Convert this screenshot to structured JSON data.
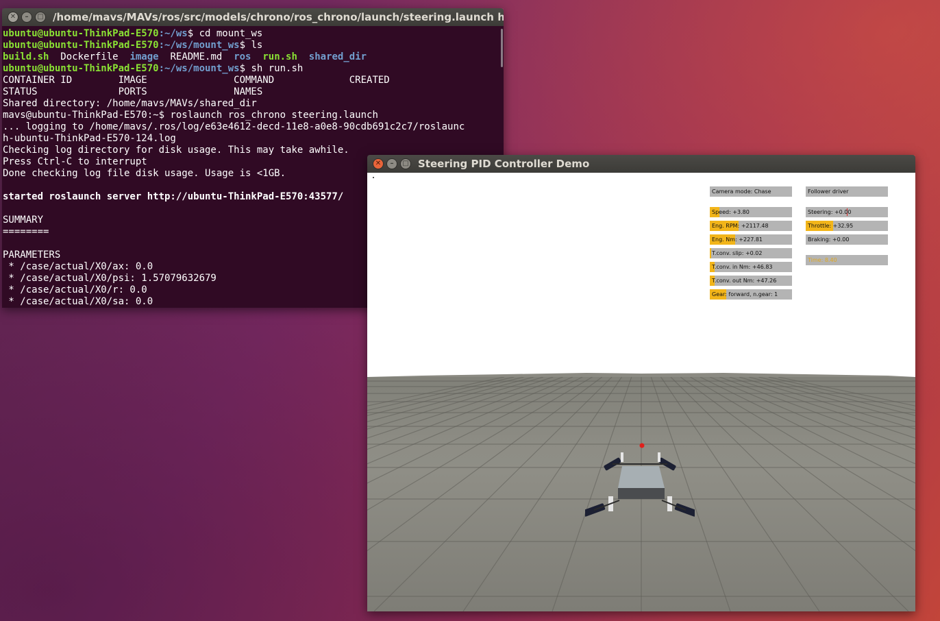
{
  "terminal": {
    "title": "/home/mavs/MAVs/ros/src/models/chrono/ros_chrono/launch/steering.launch http://loc",
    "lines": [
      {
        "user": "ubuntu@ubuntu-ThinkPad-E570",
        "path": ":~/ws",
        "cmd": "$ cd mount_ws"
      },
      {
        "user": "ubuntu@ubuntu-ThinkPad-E570",
        "path": ":~/ws/mount_ws",
        "cmd": "$ ls"
      },
      {
        "ls": [
          "build.sh",
          "Dockerfile",
          "image",
          "README.md",
          "ros",
          "run.sh",
          "shared_dir"
        ]
      },
      {
        "user": "ubuntu@ubuntu-ThinkPad-E570",
        "path": ":~/ws/mount_ws",
        "cmd": "$ sh run.sh"
      },
      {
        "text": "CONTAINER ID        IMAGE               COMMAND             CREATED"
      },
      {
        "text": "STATUS              PORTS               NAMES"
      },
      {
        "text": "Shared directory: /home/mavs/MAVs/shared_dir"
      },
      {
        "text": "mavs@ubuntu-ThinkPad-E570:~$ roslaunch ros_chrono steering.launch"
      },
      {
        "text": "... logging to /home/mavs/.ros/log/e63e4612-decd-11e8-a0e8-90cdb691c2c7/roslaunc"
      },
      {
        "text": "h-ubuntu-ThinkPad-E570-124.log"
      },
      {
        "text": "Checking log directory for disk usage. This may take awhile."
      },
      {
        "text": "Press Ctrl-C to interrupt"
      },
      {
        "text": "Done checking log file disk usage. Usage is <1GB."
      },
      {
        "text": ""
      },
      {
        "text": "started roslaunch server http://ubuntu-ThinkPad-E570:43577/",
        "bold": true
      },
      {
        "text": ""
      },
      {
        "text": "SUMMARY"
      },
      {
        "text": "========"
      },
      {
        "text": ""
      },
      {
        "text": "PARAMETERS"
      },
      {
        "text": " * /case/actual/X0/ax: 0.0"
      },
      {
        "text": " * /case/actual/X0/psi: 1.57079632679"
      },
      {
        "text": " * /case/actual/X0/r: 0.0"
      },
      {
        "text": " * /case/actual/X0/sa: 0.0"
      }
    ]
  },
  "demo": {
    "title": "Steering PID Controller Demo",
    "hud_left": [
      {
        "text": "Camera mode: Chase",
        "fill": 0
      },
      {
        "text": "Speed: +3.80",
        "fill": 0.12
      },
      {
        "text": "Eng. RPM: +2117.48",
        "fill": 0.35
      },
      {
        "text": "Eng. Nm: +227.81",
        "fill": 0.31
      },
      {
        "text": "T.conv. slip: +0.02",
        "fill": 0.02
      },
      {
        "text": "T.conv. in  Nm: +46.83",
        "fill": 0.06
      },
      {
        "text": "T.conv. out Nm: +47.26",
        "fill": 0.06
      },
      {
        "text": "Gear: forward, n.gear: 1",
        "fill": 0.2
      }
    ],
    "hud_right": [
      {
        "text": "Follower driver",
        "fill": 0
      },
      {
        "text": "Steering: +0.00",
        "fill": 0,
        "marker": 0.5
      },
      {
        "text": "Throttle: +32.95",
        "fill": 0.33
      },
      {
        "text": "Braking: +0.00",
        "fill": 0
      },
      {
        "text": "Time: 8.40",
        "fill": 0,
        "dim": true
      }
    ]
  },
  "colors": {
    "terminal_bg": "#300a24",
    "prompt_user": "#8ae234",
    "prompt_path": "#729fcf",
    "hud_fill": "#f2b51a",
    "hud_bg": "#b4b4b4",
    "close_button": "#e8643a"
  }
}
